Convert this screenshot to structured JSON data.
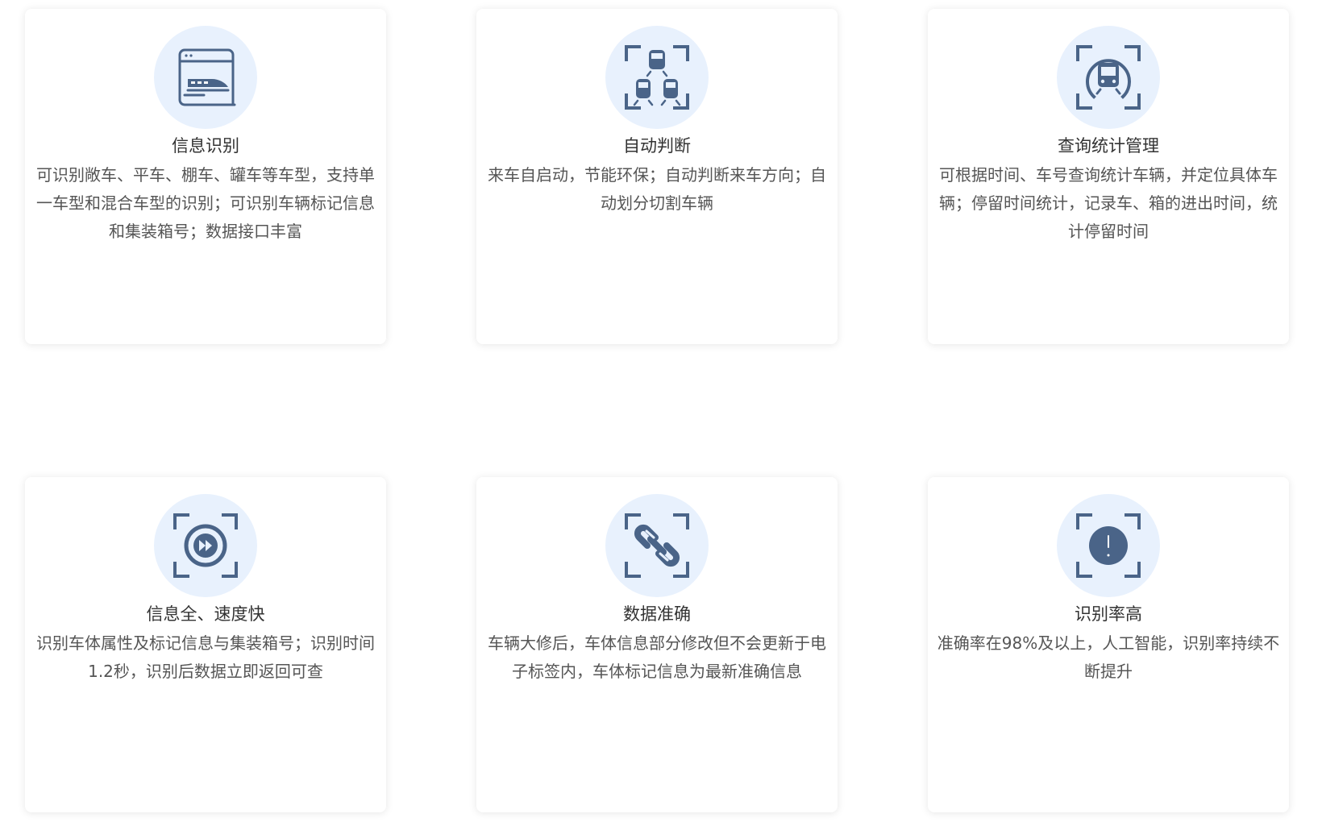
{
  "colors": {
    "icon_stroke": "#4a6488",
    "icon_bg": "#e8f1fd",
    "title": "#333333",
    "desc": "#555555"
  },
  "cards": [
    {
      "icon": "browser-train-icon",
      "title": "信息识别",
      "desc": "可识别敞车、平车、棚车、罐车等车型，支持单一车型和混合车型的识别；可识别车辆标记信息和集装箱号；数据接口丰富"
    },
    {
      "icon": "trains-scan-icon",
      "title": "自动判断",
      "desc": "来车自启动，节能环保；自动判断来车方向；自动划分切割车辆"
    },
    {
      "icon": "metro-scan-icon",
      "title": "查询统计管理",
      "desc": "可根据时间、车号查询统计车辆，并定位具体车辆；停留时间统计，记录车、箱的进出时间，统计停留时间"
    },
    {
      "icon": "fast-forward-scan-icon",
      "title": "信息全、速度快",
      "desc": "识别车体属性及标记信息与集装箱号；识别时间1.2秒，识别后数据立即返回可查"
    },
    {
      "icon": "link-scan-icon",
      "title": "数据准确",
      "desc": "车辆大修后，车体信息部分修改但不会更新于电子标签内，车体标记信息为最新准确信息"
    },
    {
      "icon": "alert-scan-icon",
      "title": "识别率高",
      "desc": "准确率在98%及以上，人工智能，识别率持续不断提升"
    }
  ]
}
